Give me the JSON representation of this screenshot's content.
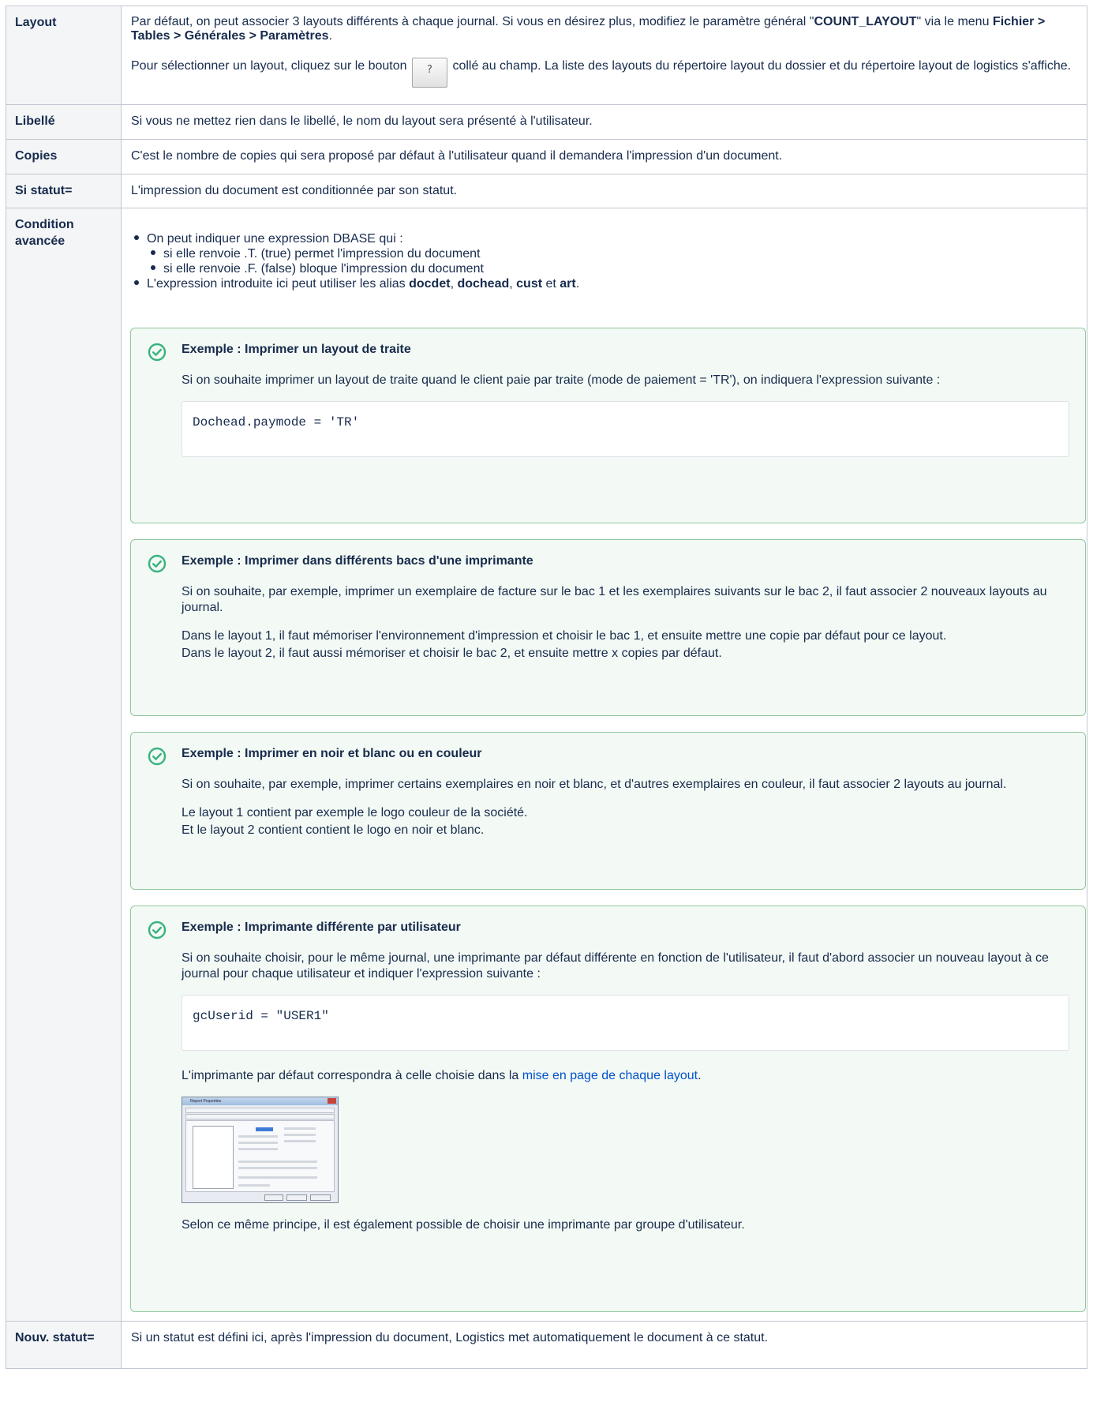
{
  "rows": {
    "layout": {
      "key": "Layout",
      "p1_a": "Par défaut, on peut associer 3 layouts différents à chaque journal. Si vous en désirez plus, modifiez le paramètre général \"",
      "p1_b": "COUNT_LAYOUT",
      "p1_c": "\" via le menu ",
      "p1_d": "Fichier > Tables > Générales > Paramètres",
      "p1_e": ".",
      "p2_a": "Pour sélectionner un layout, cliquez sur le bouton ",
      "btn": "?",
      "p2_b": " collé au champ. La liste des layouts du répertoire layout du dossier et du répertoire layout de logistics s'affiche."
    },
    "libelle": {
      "key": "Libellé",
      "text": "Si vous ne mettez rien dans le libellé, le nom du layout sera présenté à l'utilisateur."
    },
    "copies": {
      "key": "Copies",
      "text": "C'est le nombre de copies qui sera proposé par défaut à l'utilisateur quand il demandera l'impression d'un document."
    },
    "sistatut": {
      "key": "Si statut=",
      "text": "L'impression du document est conditionnée par son statut."
    },
    "condition": {
      "key": "Condition avancée",
      "b1": "On peut indiquer une expression DBASE qui :",
      "b1a": "si elle renvoie .T. (true) permet l'impression du document",
      "b1b": "si elle renvoie .F. (false) bloque l'impression du document",
      "b2_a": "L'expression introduite ici peut utiliser les alias ",
      "b2_b": "docdet",
      "b2_c": ", ",
      "b2_d": "dochead",
      "b2_e": ", ",
      "b2_f": "cust",
      "b2_g": " et ",
      "b2_h": "art",
      "b2_i": ".",
      "ex1": {
        "title": "Exemple : Imprimer un layout de traite",
        "p1": "Si on souhaite imprimer un layout de traite quand le client paie par traite (mode de paiement = 'TR'), on indiquera l'expression suivante :",
        "code": "Dochead.paymode = 'TR'"
      },
      "ex2": {
        "title": "Exemple : Imprimer dans différents bacs d'une imprimante",
        "p1": "Si on souhaite, par exemple, imprimer un exemplaire de facture sur le bac 1 et les exemplaires suivants sur le bac 2, il faut associer 2 nouveaux layouts au journal.",
        "p2": "Dans le layout 1, il faut mémoriser l'environnement d'impression et choisir le bac 1, et ensuite mettre une copie par défaut pour ce layout.",
        "p3": "Dans le layout 2, il faut aussi mémoriser et choisir le bac 2, et ensuite mettre x copies par défaut."
      },
      "ex3": {
        "title": "Exemple : Imprimer en noir et blanc ou en couleur",
        "p1": "Si on souhaite, par exemple, imprimer certains exemplaires en noir et blanc, et d'autres exemplaires en couleur, il faut associer 2 layouts au journal.",
        "p2": "Le layout 1 contient par exemple le logo couleur de la société.",
        "p3": "Et le layout 2 contient contient le logo en noir et blanc."
      },
      "ex4": {
        "title": "Exemple : Imprimante différente par utilisateur",
        "p1": "Si on souhaite choisir, pour le même journal, une imprimante par défaut différente en fonction de l'utilisateur, il faut d'abord associer un nouveau layout à ce journal pour chaque utilisateur et indiquer l'expression suivante :",
        "code": "gcUserid = \"USER1\"",
        "p2_a": "L'imprimante par défaut correspondra à celle choisie dans la ",
        "p2_link": "mise en page de chaque layout",
        "p2_b": ".",
        "thumb_title": "Report Properties",
        "p3": "Selon ce même principe, il est également possible de choisir une imprimante par groupe d'utilisateur."
      }
    },
    "nouvstatut": {
      "key": "Nouv. statut=",
      "text": "Si un statut est défini ici, après l'impression du document, Logistics met automatiquement le document à ce statut."
    }
  },
  "icons": {
    "check": "check-circle-icon",
    "help": "question-mark-icon"
  },
  "colors": {
    "panel_border": "#8fc89b",
    "panel_bg": "#f3f9f4",
    "check": "#36b37e",
    "link": "#0052cc",
    "key_bg": "#f4f5f7"
  }
}
